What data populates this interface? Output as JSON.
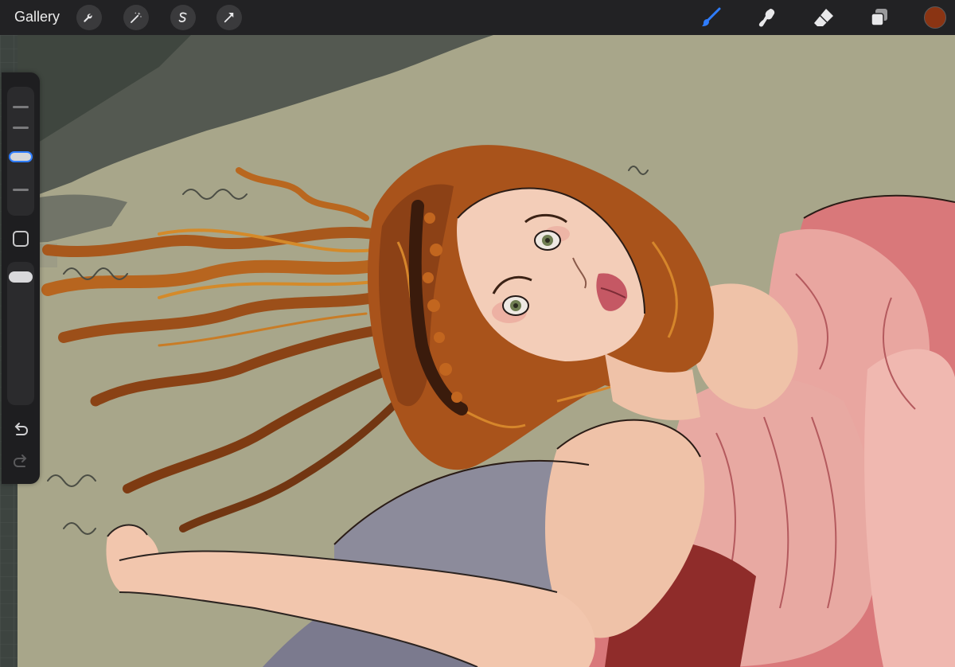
{
  "toolbar": {
    "gallery_label": "Gallery",
    "left_tools": [
      "wrench-icon",
      "magic-wand-icon",
      "selection-s-icon",
      "transform-arrow-icon"
    ],
    "right_tools": [
      "brush-icon",
      "smudge-icon",
      "eraser-icon",
      "layers-icon"
    ],
    "active_tool": "brush-icon",
    "color_swatch": "#8a3413",
    "accent_color": "#2f7dff"
  },
  "sidebar": {
    "brush_size_level": 0.45,
    "opacity_level": 0.95,
    "buttons": [
      "modify-square-icon",
      "undo-icon",
      "redo-icon"
    ]
  },
  "canvas": {
    "background_color": "#a8a68a",
    "artwork": "illustration"
  }
}
